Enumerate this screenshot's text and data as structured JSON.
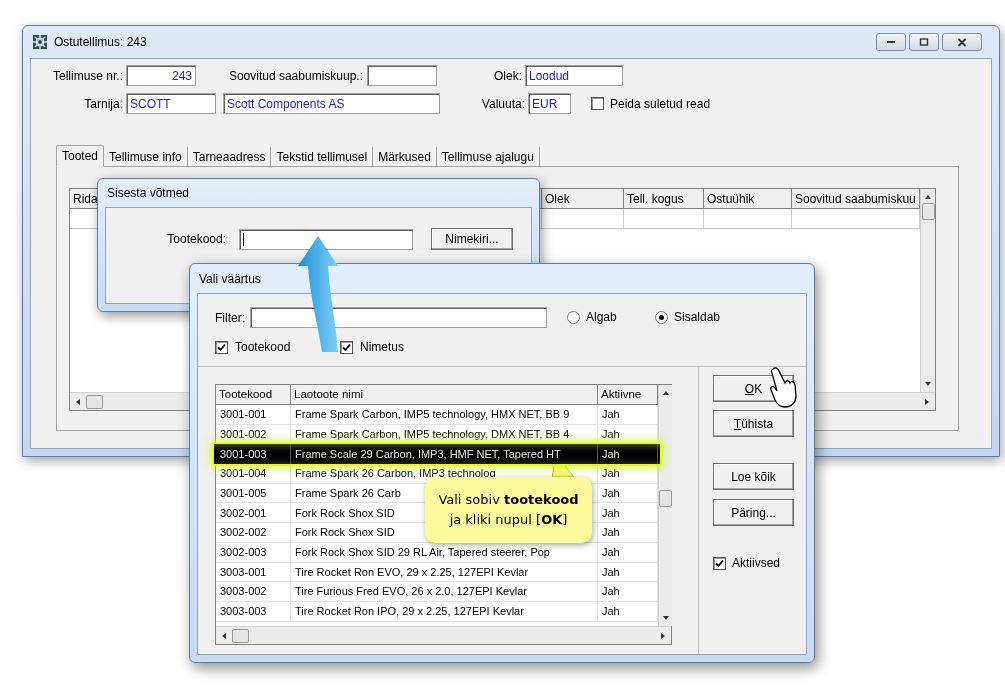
{
  "main_window": {
    "title": "Ostutellimus: 243",
    "order_no": {
      "label": "Tellimuse nr.:",
      "value": "243"
    },
    "desired_date": {
      "label": "Soovitud saabumiskuup.:"
    },
    "status": {
      "label": "Olek:",
      "value": "Loodud"
    },
    "supplier": {
      "label": "Tarnija:",
      "code": "SCOTT",
      "name": "Scott Components AS"
    },
    "currency": {
      "label": "Valuuta:",
      "value": "EUR"
    },
    "hide_closed": {
      "label": "Peida suletud read",
      "checked": false
    },
    "tabs": [
      {
        "label": "Tooted",
        "selected": true
      },
      {
        "label": "Tellimuse info",
        "selected": false
      },
      {
        "label": "Tarneaadress",
        "selected": false
      },
      {
        "label": "Tekstid tellimusel",
        "selected": false
      },
      {
        "label": "Märkused",
        "selected": false
      },
      {
        "label": "Tellimuse ajalugu",
        "selected": false
      }
    ],
    "grid": {
      "columns": [
        "Rida",
        "Olek",
        "Tell. kogus",
        "Ostuühik",
        "Soovitud saabumiskuu"
      ]
    }
  },
  "key_dialog": {
    "title": "Sisesta võtmed",
    "field_label": "Tootekood:",
    "button": "Nimekiri..."
  },
  "pick_dialog": {
    "title": "Vali väärtus",
    "filter_label": "Filter:",
    "match": [
      {
        "label": "Algab",
        "selected": false
      },
      {
        "label": "Sisaldab",
        "selected": true
      }
    ],
    "search_in": [
      {
        "label": "Tootekood",
        "checked": true
      },
      {
        "label": "Nimetus",
        "checked": true
      }
    ],
    "columns": [
      "Tootekood",
      "Laotoote nimi",
      "Aktiivne"
    ],
    "rows": [
      {
        "code": "3001-001",
        "name": "Frame Spark Carbon, IMP5 technology, HMX NET, BB 9",
        "active": "Jah",
        "selected": false
      },
      {
        "code": "3001-002",
        "name": "Frame Spark Carbon, IMP5 technology, DMX NET, BB 4",
        "active": "Jah",
        "selected": false
      },
      {
        "code": "3001-003",
        "name": "Frame Scale 29 Carbon, IMP3, HMF NET, Tapered HT",
        "active": "Jah",
        "selected": true
      },
      {
        "code": "3001-004",
        "name": "Frame Spark 26 Carbon, IMP3 technolog",
        "active": "Jah",
        "selected": false
      },
      {
        "code": "3001-005",
        "name": "Frame Spark 26 Carb",
        "active": "Jah",
        "selected": false
      },
      {
        "code": "3002-001",
        "name": "Fork Rock Shox SID",
        "active": "Jah",
        "selected": false
      },
      {
        "code": "3002-002",
        "name": "Fork Rock Shox SID",
        "active": "Jah",
        "selected": false
      },
      {
        "code": "3002-003",
        "name": "Fork Rock Shox SID 29 RL Air, Tapered steerer, Pop",
        "active": "Jah",
        "selected": false
      },
      {
        "code": "3003-001",
        "name": "Tire Rocket Ron EVO, 29 x 2.25, 127EPI Kevlar",
        "active": "Jah",
        "selected": false
      },
      {
        "code": "3003-002",
        "name": "Tire Furious Fred EVO, 26 x 2.0, 127EPI Kevlar",
        "active": "Jah",
        "selected": false
      },
      {
        "code": "3003-003",
        "name": "Tire Rocket Ron IPO, 29 x 2.25, 127EPI Kevlar",
        "active": "Jah",
        "selected": false
      }
    ],
    "buttons": [
      {
        "label": "OK",
        "accelerator": true
      },
      {
        "label": "Tühista",
        "accelerator": true
      },
      {
        "label": "Loe kõik",
        "accelerator": false
      },
      {
        "label": "Päring...",
        "accelerator": false
      }
    ],
    "active_only": {
      "label": "Aktiivsed",
      "checked": true
    }
  },
  "callout": {
    "text": "Vali sobiv **tootekood**\nja kliki nupul [**OK**]"
  }
}
